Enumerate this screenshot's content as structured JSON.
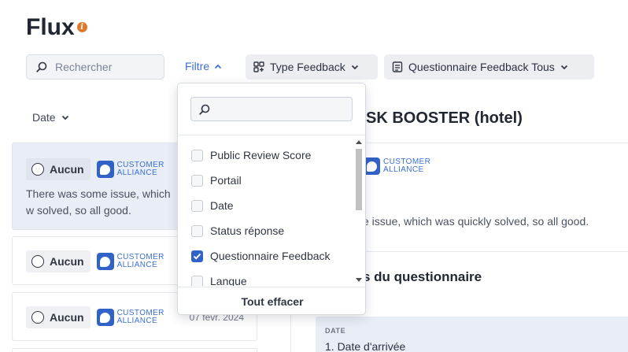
{
  "page": {
    "title": "Flux",
    "info_icon": "info-icon"
  },
  "toolbar": {
    "search_placeholder": "Rechercher",
    "filter_label": "Filtre",
    "type_feedback_label": "Type Feedback",
    "questionnaire_label": "Questionnaire Feedback",
    "questionnaire_value": "Tous"
  },
  "list": {
    "sort_label": "Date",
    "cards": [
      {
        "status": "Aucun",
        "brand_line1": "CUSTOMER",
        "brand_line2": "ALLIANCE",
        "text": "There was some issue, which was quickly solved, so all good.",
        "text_visible": "There was some issue, which w solved, so all good.",
        "date": ""
      },
      {
        "status": "Aucun",
        "brand_line1": "CUSTOMER",
        "brand_line2": "ALLIANCE",
        "text": "",
        "date": ""
      },
      {
        "status": "Aucun",
        "brand_line1": "CUSTOMER",
        "brand_line2": "ALLIANCE",
        "text": "",
        "date": "07 févr. 2024"
      }
    ]
  },
  "detail": {
    "title": "SK BOOSTER (hotel)",
    "brand_line1": "CUSTOMER",
    "brand_line2": "ALLIANCE",
    "text": "e issue, which was quickly solved, so all good.",
    "section_title": "s du questionnaire",
    "qa_label": "DATE",
    "qa_question": "1. Date d'arrivée"
  },
  "filter_dropdown": {
    "search_placeholder": "",
    "items": [
      {
        "label": "Public Review Score",
        "checked": false
      },
      {
        "label": "Portail",
        "checked": false
      },
      {
        "label": "Date",
        "checked": false
      },
      {
        "label": "Status réponse",
        "checked": false
      },
      {
        "label": "Questionnaire Feedback",
        "checked": true
      },
      {
        "label": "Langue",
        "checked": false
      }
    ],
    "clear_all": "Tout effacer"
  },
  "colors": {
    "accent": "#3162c8",
    "link": "#3b6fd4",
    "info": "#e0782a",
    "card_active": "#e9edf6"
  }
}
